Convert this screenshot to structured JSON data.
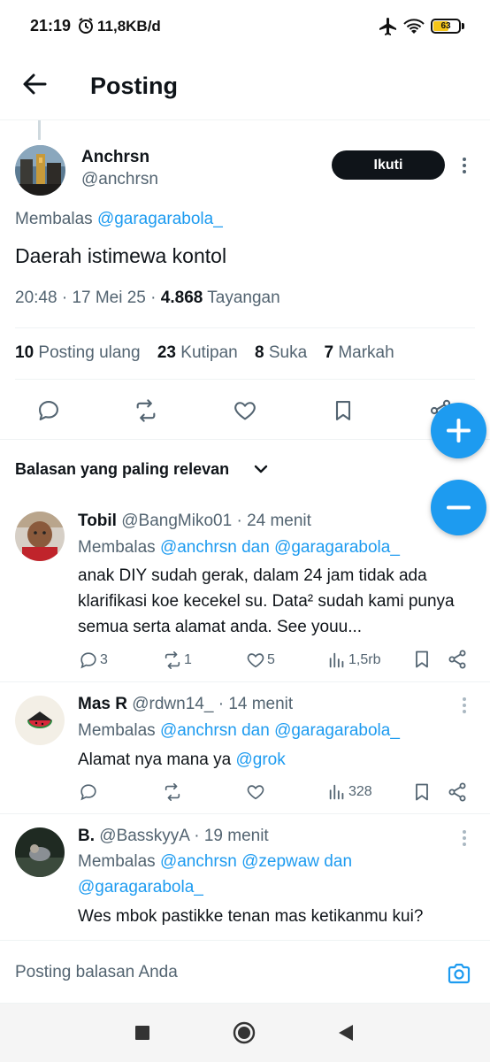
{
  "status_bar": {
    "time": "21:19",
    "speed": "11,8KB/d",
    "battery": "63",
    "battery_fraction": 0.63
  },
  "header": {
    "title": "Posting"
  },
  "post": {
    "author_name": "Anchrsn",
    "author_handle": "@anchrsn",
    "follow_label": "Ikuti",
    "reply_prefix": "Membalas",
    "reply_mention": "@garagarabola_",
    "text": "Daerah istimewa kontol",
    "time": "20:48",
    "date": "17 Mei 25",
    "views": "4.868",
    "views_label": "Tayangan",
    "stats": {
      "reposts": "10",
      "reposts_label": "Posting ulang",
      "quotes": "23",
      "quotes_label": "Kutipan",
      "likes": "8",
      "likes_label": "Suka",
      "bookmarks": "7",
      "bookmarks_label": "Markah"
    }
  },
  "sort_label": "Balasan yang paling relevan",
  "replies": [
    {
      "name": "Tobil",
      "handle": "@BangMiko01",
      "time": "24 menit",
      "reply_prefix": "Membalas",
      "mentions": "@anchrsn dan @garagarabola_",
      "text": "anak DIY sudah gerak, dalam 24 jam tidak ada klarifikasi koe kecekel su. Data² sudah kami punya semua serta alamat anda. See youu...",
      "comments": "3",
      "reposts": "1",
      "likes": "5",
      "views": "1,5rb"
    },
    {
      "name": "Mas R",
      "handle": "@rdwn14_",
      "time": "14 menit",
      "reply_prefix": "Membalas",
      "mentions": "@anchrsn dan @garagarabola_",
      "text_prefix": "Alamat nya mana ya ",
      "text_mention": "@grok",
      "views": "328"
    },
    {
      "name": "B.",
      "handle": "@BasskyyA",
      "time": "19 menit",
      "reply_prefix": "Membalas",
      "mentions_line1": "@anchrsn @zepwaw dan",
      "mentions_line2": "@garagarabola_",
      "text": "Wes mbok pastikke tenan mas ketikanmu kui?"
    }
  ],
  "compose": {
    "placeholder": "Posting balasan Anda"
  },
  "colors": {
    "accent": "#1d9bf0",
    "text": "#0f1419",
    "muted": "#536471"
  },
  "icons": [
    "back-arrow-icon",
    "kebab-icon",
    "reply-icon",
    "repost-icon",
    "heart-icon",
    "bookmark-icon",
    "share-icon",
    "plus-icon",
    "minus-icon",
    "chevron-down-icon",
    "views-icon",
    "camera-icon"
  ]
}
